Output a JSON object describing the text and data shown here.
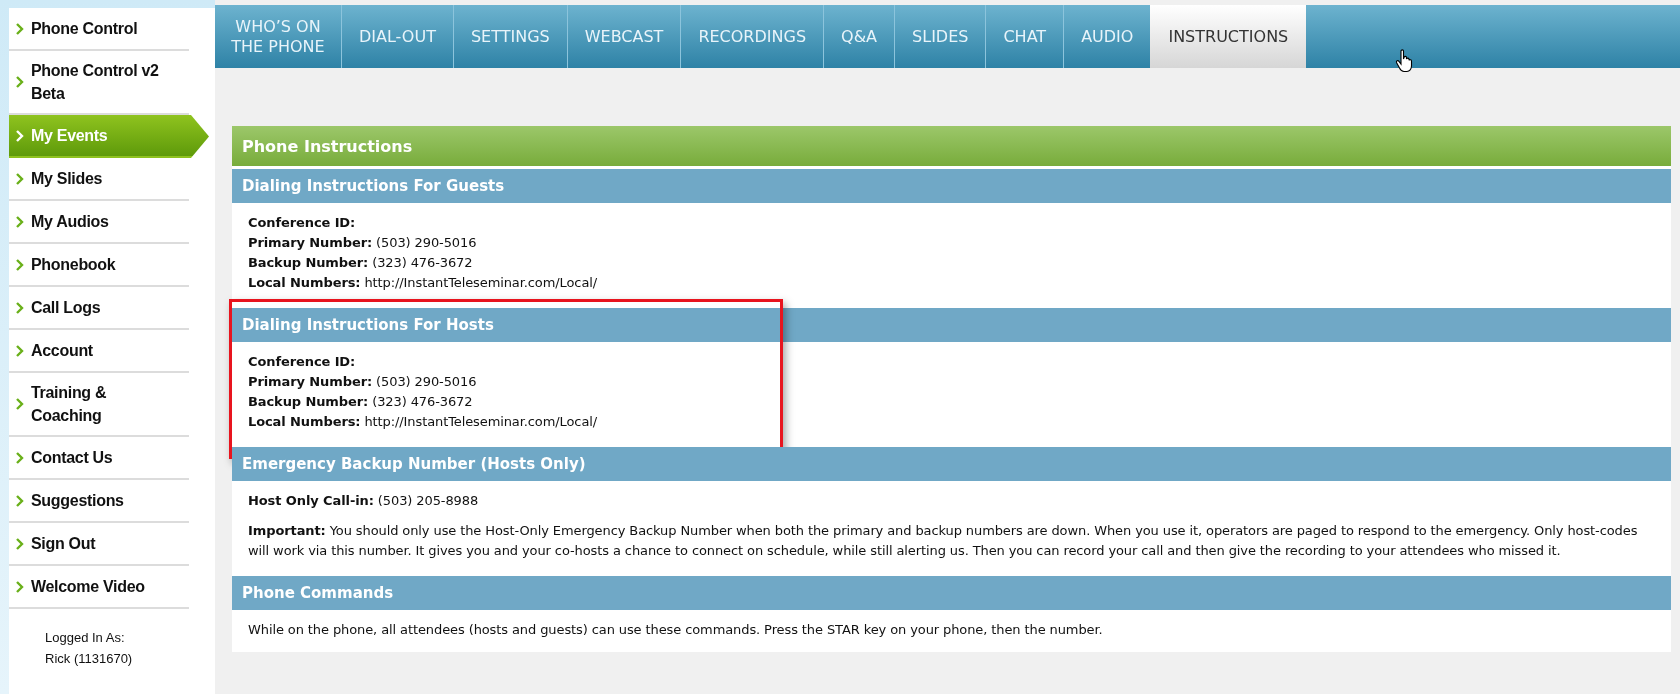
{
  "sidebar": {
    "items": [
      {
        "label": "Phone Control",
        "selected": false
      },
      {
        "label": "Phone Control v2 Beta",
        "selected": false
      },
      {
        "label": "My Events",
        "selected": true
      },
      {
        "label": "My Slides",
        "selected": false
      },
      {
        "label": "My Audios",
        "selected": false
      },
      {
        "label": "Phonebook",
        "selected": false
      },
      {
        "label": "Call Logs",
        "selected": false
      },
      {
        "label": "Account",
        "selected": false
      },
      {
        "label": "Training & Coaching",
        "selected": false
      },
      {
        "label": "Contact Us",
        "selected": false
      },
      {
        "label": "Suggestions",
        "selected": false
      },
      {
        "label": "Sign Out",
        "selected": false
      },
      {
        "label": "Welcome Video",
        "selected": false
      }
    ],
    "logged_in_label": "Logged In As:",
    "logged_in_user": "Rick (1131670)"
  },
  "tabs": [
    {
      "label": "WHO’S ON THE PHONE",
      "selected": false
    },
    {
      "label": "DIAL-OUT",
      "selected": false
    },
    {
      "label": "SETTINGS",
      "selected": false
    },
    {
      "label": "WEBCAST",
      "selected": false
    },
    {
      "label": "RECORDINGS",
      "selected": false
    },
    {
      "label": "Q&A",
      "selected": false
    },
    {
      "label": "SLIDES",
      "selected": false
    },
    {
      "label": "CHAT",
      "selected": false
    },
    {
      "label": "AUDIO",
      "selected": false
    },
    {
      "label": "INSTRUCTIONS",
      "selected": true
    }
  ],
  "panel": {
    "title": "Phone Instructions",
    "sections": [
      {
        "title": "Dialing Instructions For Guests",
        "highlighted": false,
        "items": [
          {
            "kind": "line",
            "text": "**Conference ID:**"
          },
          {
            "kind": "line",
            "text": "**Primary Number:** (503) 290-5016"
          },
          {
            "kind": "line",
            "text": "**Backup Number:** (323) 476-3672"
          },
          {
            "kind": "line",
            "text": "**Local Numbers:** http://InstantTeleseminar.com/Local/"
          }
        ]
      },
      {
        "title": "Dialing Instructions For Hosts",
        "highlighted": true,
        "items": [
          {
            "kind": "line",
            "text": "**Conference ID:**"
          },
          {
            "kind": "line",
            "text": "**Primary Number:** (503) 290-5016"
          },
          {
            "kind": "line",
            "text": "**Backup Number:** (323) 476-3672"
          },
          {
            "kind": "line",
            "text": "**Local Numbers:** http://InstantTeleseminar.com/Local/"
          }
        ]
      },
      {
        "title": "Emergency Backup Number (Hosts Only)",
        "highlighted": false,
        "items": [
          {
            "kind": "line",
            "text": "**Host Only Call-in:** (503) 205-8988"
          },
          {
            "kind": "para",
            "text": "**Important:** You should only use the Host-Only Emergency Backup Number when both the primary and backup numbers are down. When you use it, operators are paged to respond to the emergency. Only host-codes will work via this number. It gives you and your co-hosts a chance to connect on schedule, while still alerting us. Then you can record your call and then give the recording to your attendees who missed it."
          }
        ]
      },
      {
        "title": "Phone Commands",
        "highlighted": false,
        "items": [
          {
            "kind": "line",
            "text": "While on the phone, all attendees (hosts and guests) can use these commands. Press the STAR key on your phone, then the number."
          }
        ]
      }
    ]
  }
}
